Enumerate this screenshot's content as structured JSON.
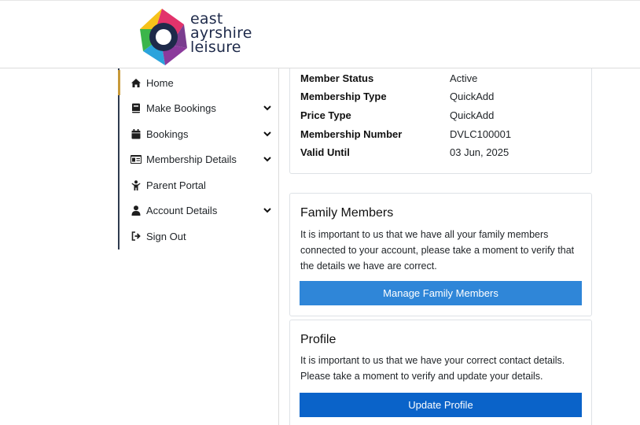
{
  "brand": {
    "logo_line1": "east",
    "logo_line2": "ayrshire",
    "logo_line3": "leisure"
  },
  "sidebar": {
    "items": [
      {
        "label": "Home",
        "icon": "home-icon",
        "expandable": false
      },
      {
        "label": "Make Bookings",
        "icon": "book-icon",
        "expandable": true
      },
      {
        "label": "Bookings",
        "icon": "calendar-icon",
        "expandable": true
      },
      {
        "label": "Membership Details",
        "icon": "id-card-icon",
        "expandable": true
      },
      {
        "label": "Parent Portal",
        "icon": "child-icon",
        "expandable": false
      },
      {
        "label": "Account Details",
        "icon": "user-icon",
        "expandable": true
      },
      {
        "label": "Sign Out",
        "icon": "sign-out-icon",
        "expandable": false
      }
    ]
  },
  "membership": {
    "rows": [
      {
        "key": "Member Status",
        "value": "Active"
      },
      {
        "key": "Membership Type",
        "value": "QuickAdd"
      },
      {
        "key": "Price Type",
        "value": "QuickAdd"
      },
      {
        "key": "Membership Number",
        "value": "DVLC100001"
      },
      {
        "key": "Valid Until",
        "value": "03 Jun, 2025"
      }
    ]
  },
  "family": {
    "title": "Family Members",
    "text": "It is important to us that we have all your family members connected to your account, please take a moment to verify that the details we have are correct.",
    "button": "Manage Family Members"
  },
  "profile": {
    "title": "Profile",
    "text": "It is important to us that we have your correct contact details. Please take a moment to verify and update your details.",
    "button": "Update Profile"
  },
  "colors": {
    "accent_button": "#2f86d8",
    "primary_button": "#0a63c9",
    "active_marker": "#c89a3a",
    "sidebar_border": "#2f3b4f"
  }
}
